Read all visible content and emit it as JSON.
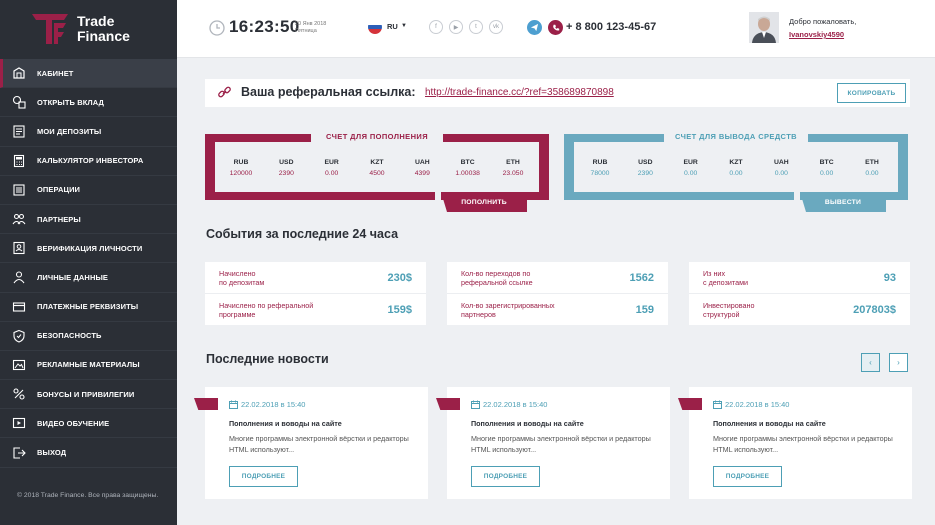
{
  "colors": {
    "accent": "#9b2048",
    "secondary": "#4d9fb5",
    "sidebar_bg": "#2b2f36",
    "page_bg": "#eef0f3"
  },
  "logo": {
    "line1": "Trade",
    "line2": "Finance",
    "icon": "tf-logo"
  },
  "sidebar": {
    "items": [
      {
        "label": "КАБИНЕТ",
        "icon": "cabinet-icon",
        "active": true
      },
      {
        "label": "ОТКРЫТЬ ВКЛАД",
        "icon": "open-deposit-icon"
      },
      {
        "label": "МОИ ДЕПОЗИТЫ",
        "icon": "deposits-icon"
      },
      {
        "label": "КАЛЬКУЛЯТОР ИНВЕСТОРА",
        "icon": "calculator-icon"
      },
      {
        "label": "ОПЕРАЦИИ",
        "icon": "operations-icon"
      },
      {
        "label": "ПАРТНЕРЫ",
        "icon": "partners-icon"
      },
      {
        "label": "ВЕРИФИКАЦИЯ ЛИЧНОСТИ",
        "icon": "verification-icon"
      },
      {
        "label": "ЛИЧНЫЕ ДАННЫЕ",
        "icon": "personal-data-icon"
      },
      {
        "label": "ПЛАТЕЖНЫЕ РЕКВИЗИТЫ",
        "icon": "payment-details-icon"
      },
      {
        "label": "БЕЗОПАСНОСТЬ",
        "icon": "security-icon"
      },
      {
        "label": "РЕКЛАМНЫЕ МАТЕРИАЛЫ",
        "icon": "ad-materials-icon"
      },
      {
        "label": "БОНУСЫ И ПРИВИЛЕГИИ",
        "icon": "bonuses-icon"
      },
      {
        "label": "ВИДЕО ОБУЧЕНИЕ",
        "icon": "video-icon"
      },
      {
        "label": "ВЫХОД",
        "icon": "logout-icon"
      }
    ],
    "copyright": "© 2018 Trade Finance. Все права защищены."
  },
  "header": {
    "time": "16:23:50",
    "date_line1": "20 Янв 2018",
    "date_line2": "Пятница",
    "language": "RU",
    "social": [
      "facebook-icon",
      "youtube-icon",
      "twitter-icon",
      "vk-icon"
    ],
    "phone": "+ 8 800 123-45-67",
    "welcome": "Добро пожаловать,",
    "username": "Ivanovskiy4590"
  },
  "referral": {
    "title": "Ваша реферальная ссылка:",
    "link": "http://trade-finance.cc/?ref=358689870898",
    "copy_label": "КОПИРОВАТЬ"
  },
  "deposit_account": {
    "title": "СЧЕТ ДЛЯ ПОПОЛНЕНИЯ",
    "currencies": [
      {
        "code": "RUB",
        "value": "120000"
      },
      {
        "code": "USD",
        "value": "2390"
      },
      {
        "code": "EUR",
        "value": "0.00"
      },
      {
        "code": "KZT",
        "value": "4500"
      },
      {
        "code": "UAH",
        "value": "4399"
      },
      {
        "code": "BTC",
        "value": "1.00038"
      },
      {
        "code": "ETH",
        "value": "23.050"
      }
    ],
    "button": "ПОПОЛНИТЬ"
  },
  "withdraw_account": {
    "title": "СЧЕТ ДЛЯ ВЫВОДА СРЕДСТВ",
    "currencies": [
      {
        "code": "RUB",
        "value": "78000"
      },
      {
        "code": "USD",
        "value": "2390"
      },
      {
        "code": "EUR",
        "value": "0.00"
      },
      {
        "code": "KZT",
        "value": "0.00"
      },
      {
        "code": "UAH",
        "value": "0.00"
      },
      {
        "code": "BTC",
        "value": "0.00"
      },
      {
        "code": "ETH",
        "value": "0.00"
      }
    ],
    "button": "ВЫВЕСТИ"
  },
  "events": {
    "title": "События за последние 24 часа",
    "cards": [
      {
        "rows": [
          {
            "label1": "Начислено",
            "label2": "по депозитам",
            "value": "230$"
          },
          {
            "label1": "Начислено по реферальной",
            "label2": "программе",
            "value": "159$"
          }
        ]
      },
      {
        "rows": [
          {
            "label1": "Кол-во переходов по",
            "label2": "реферальной ссылке",
            "value": "1562"
          },
          {
            "label1": "Кол-во зарегистрированных",
            "label2": "партнеров",
            "value": "159"
          }
        ]
      },
      {
        "rows": [
          {
            "label1": "Из них",
            "label2": "с депозитами",
            "value": "93"
          },
          {
            "label1": "Инвестировано",
            "label2": "структурой",
            "value": "207803$"
          }
        ]
      }
    ]
  },
  "news": {
    "title": "Последние новости",
    "items": [
      {
        "date": "22.02.2018 в 15:40",
        "title": "Пополнения и воводы на сайте",
        "text": "Многие программы электронной вёрстки и редакторы HTML используют...",
        "more": "ПОДРОБНЕЕ"
      },
      {
        "date": "22.02.2018 в 15:40",
        "title": "Пополнения и воводы на сайте",
        "text": "Многие программы электронной вёрстки и редакторы HTML используют...",
        "more": "ПОДРОБНЕЕ"
      },
      {
        "date": "22.02.2018 в 15:40",
        "title": "Пополнения и воводы на сайте",
        "text": "Многие программы электронной вёрстки и редакторы HTML используют...",
        "more": "ПОДРОБНЕЕ"
      }
    ]
  }
}
